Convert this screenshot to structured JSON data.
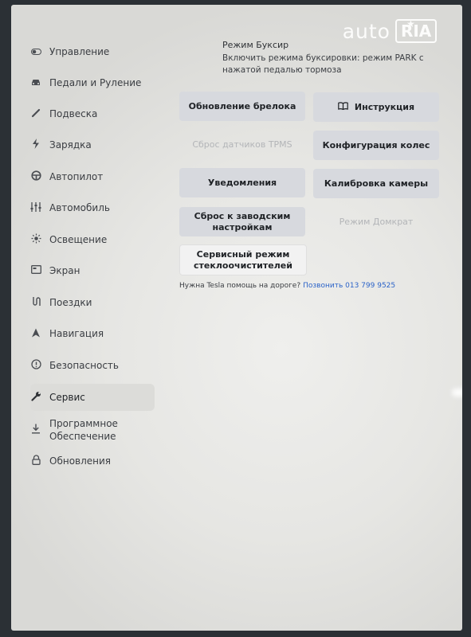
{
  "sidebar": {
    "items": [
      {
        "label": "Управление",
        "icon": "toggle-icon"
      },
      {
        "label": "Педали и Руление",
        "icon": "car-icon"
      },
      {
        "label": "Подвеска",
        "icon": "suspension-icon"
      },
      {
        "label": "Зарядка",
        "icon": "bolt-icon"
      },
      {
        "label": "Автопилот",
        "icon": "steering-wheel-icon"
      },
      {
        "label": "Автомобиль",
        "icon": "sliders-icon"
      },
      {
        "label": "Освещение",
        "icon": "sun-icon"
      },
      {
        "label": "Экран",
        "icon": "display-icon"
      },
      {
        "label": "Поездки",
        "icon": "trips-icon"
      },
      {
        "label": "Навигация",
        "icon": "navigation-icon"
      },
      {
        "label": "Безопасность",
        "icon": "info-icon"
      },
      {
        "label": "Сервис",
        "icon": "wrench-icon",
        "active": true
      },
      {
        "label": "Программное Обеспечение",
        "icon": "download-icon"
      },
      {
        "label": "Обновления",
        "icon": "lock-icon"
      }
    ]
  },
  "tow": {
    "title": "Режим Буксир",
    "description": "Включить режима буксировки: режим PARK с нажатой педалью тормоза"
  },
  "buttons": {
    "fob_update": "Обновление брелока",
    "manual": "Инструкция",
    "tpms_reset": "Сброс датчиков TPMS",
    "wheel_config": "Конфигурация колес",
    "notifications": "Уведомления",
    "camera_calibration": "Калибровка камеры",
    "factory_reset": "Сброс к заводским настройкам",
    "jack_mode": "Режим Домкрат",
    "wiper_service": "Сервисный режим стеклоочистителей"
  },
  "help": {
    "text": "Нужна Tesla помощь на дороге?",
    "link": "Позвонить 013 799 9525"
  },
  "watermark": {
    "left": "auto",
    "right": "RIA"
  }
}
